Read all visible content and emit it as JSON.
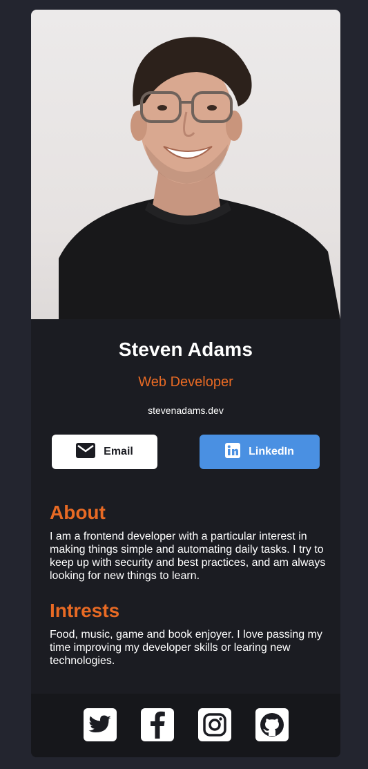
{
  "profile": {
    "name": "Steven Adams",
    "role": "Web Developer",
    "website": "stevenadams.dev"
  },
  "buttons": {
    "email": "Email",
    "linkedin": "LinkedIn"
  },
  "sections": {
    "about": {
      "heading": "About",
      "body": "I am a frontend developer with a particular interest in making things simple and automating daily tasks. I try to keep up with security and best practices, and am always looking for new things to learn."
    },
    "interests": {
      "heading": "Intrests",
      "body": "Food, music, game and book enjoyer. I love passing my time improving my developer skills or learing new technologies."
    }
  },
  "social": [
    "twitter-icon",
    "facebook-icon",
    "instagram-icon",
    "github-icon"
  ],
  "colors": {
    "accent": "#e86a24",
    "linkedin": "#4a90e2",
    "card": "#1b1c22",
    "page": "#23252f",
    "footer": "#16171b"
  }
}
